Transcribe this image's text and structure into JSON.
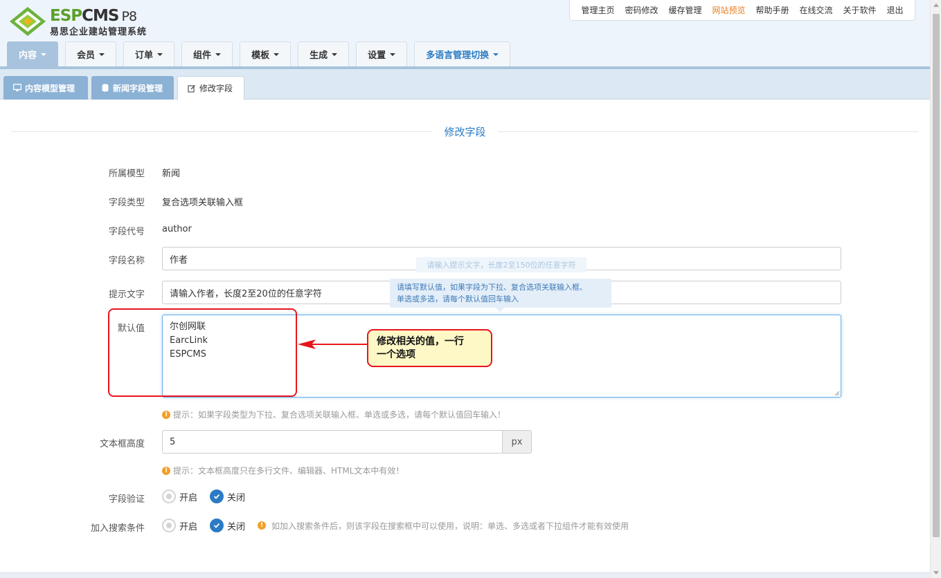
{
  "logo": {
    "brand_e": "ESP",
    "brand_c": "CMS",
    "version": "P8",
    "subtitle": "易思企业建站管理系统"
  },
  "topnav": [
    "管理主页",
    "密码修改",
    "缓存管理",
    "网站预览",
    "帮助手册",
    "在线交流",
    "关于软件",
    "退出"
  ],
  "mainnav": [
    "内容",
    "会员",
    "订单",
    "组件",
    "模板",
    "生成",
    "设置",
    "多语言管理切换"
  ],
  "subtabs": [
    "内容模型管理",
    "新闻字段管理",
    "修改字段"
  ],
  "section_title": "修改字段",
  "form": {
    "model_label": "所属模型",
    "model_value": "新闻",
    "type_label": "字段类型",
    "type_value": "复合选项关联输入框",
    "code_label": "字段代号",
    "code_value": "author",
    "name_label": "字段名称",
    "name_value": "作者",
    "tip_label": "提示文字",
    "tip_value": "请输入作者，长度2至20位的任意字符",
    "default_label": "默认值",
    "default_lines": [
      "尔创网联",
      "EarcLink",
      "ESPCMS"
    ],
    "default_hint": "提示：如果字段类型为下拉、复合选项关联输入框、单选或多选，请每个默认值回车输入！",
    "height_label": "文本框高度",
    "height_value": "5",
    "height_unit": "px",
    "height_hint": "提示：文本框高度只在多行文件、编辑器、HTML文本中有效！",
    "validate_label": "字段验证",
    "search_label": "加入搜索条件",
    "on_label": "开启",
    "off_label": "关闭",
    "search_hint": "如加入搜索条件后，则该字段在搜索框中可以使用，说明：单选、多选或者下拉组件才能有效使用"
  },
  "tooltips": {
    "faded": "请输入提示文字，长度2至150位的任意字符",
    "active_lines": [
      "请填写默认值，如果字段为下拉、复合选项关联输入框、",
      "单选或多选，请每个默认值回车输入"
    ]
  },
  "annotation": {
    "lines": [
      "修改相关的值，一行",
      "一个选项"
    ]
  },
  "colors": {
    "accent": "#2b7bc4",
    "nav_active": "#a7c3dd",
    "annotation_red": "#e8141c",
    "warning": "#f0a02a",
    "preview_link": "#e87d1e"
  }
}
